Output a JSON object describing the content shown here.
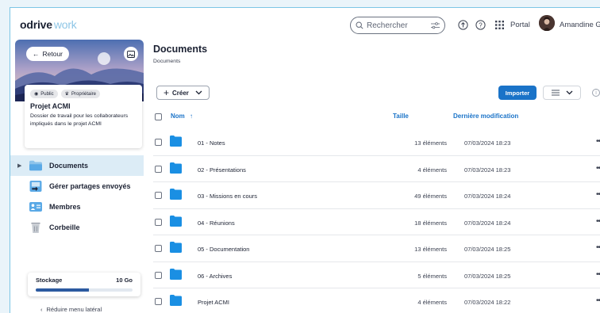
{
  "app": {
    "brand": "odrive",
    "brand_sub": "work"
  },
  "header": {
    "search_placeholder": "Rechercher",
    "portal_label": "Portal",
    "user_name": "Amandine Gira"
  },
  "sidebar": {
    "back_label": "Retour",
    "chips": [
      "Public",
      "Propriétaire"
    ],
    "project_title": "Projet ACMI",
    "project_desc": "Dossier de travail pour les collaborateurs impliqués dans le projet ACMI",
    "nav": [
      {
        "label": "Documents",
        "active": true
      },
      {
        "label": "Gérer partages envoyés",
        "active": false
      },
      {
        "label": "Membres",
        "active": false
      },
      {
        "label": "Corbeille",
        "active": false
      }
    ],
    "storage_label": "Stockage",
    "storage_value": "10 Go",
    "storage_fraction": 0.55,
    "reduce_label": "Réduire menu latéral"
  },
  "main": {
    "title": "Documents",
    "breadcrumb": "Documents",
    "create_label": "Créer",
    "import_label": "Importer",
    "columns": {
      "name": "Nom",
      "size": "Taille",
      "modified": "Dernière modification"
    },
    "rows": [
      {
        "name": "01 - Notes",
        "size": "13 éléments",
        "modified": "07/03/2024 18:23"
      },
      {
        "name": "02 - Présentations",
        "size": "4 éléments",
        "modified": "07/03/2024 18:23"
      },
      {
        "name": "03 - Missions en cours",
        "size": "49 éléments",
        "modified": "07/03/2024 18:24"
      },
      {
        "name": "04 - Réunions",
        "size": "18 éléments",
        "modified": "07/03/2024 18:24"
      },
      {
        "name": "05 - Documentation",
        "size": "13 éléments",
        "modified": "07/03/2024 18:25"
      },
      {
        "name": "06 - Archives",
        "size": "5 éléments",
        "modified": "07/03/2024 18:25"
      },
      {
        "name": "Projet ACMI",
        "size": "4 éléments",
        "modified": "07/03/2024 18:22"
      }
    ]
  },
  "colors": {
    "accent": "#1a73c8",
    "folder": "#1a8fe3",
    "active_bg": "#dcecf6"
  }
}
